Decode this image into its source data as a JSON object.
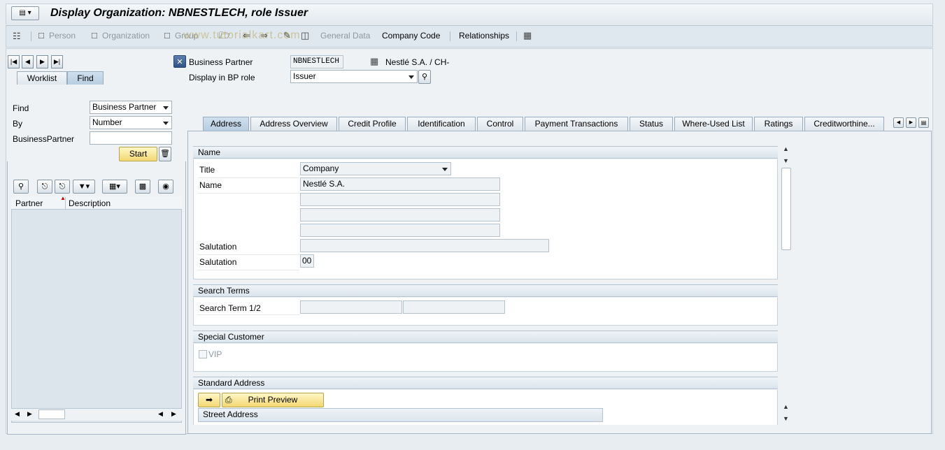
{
  "window": {
    "title": "Display Organization: NBNESTLECH, role Issuer"
  },
  "toolbar": {
    "person": "Person",
    "organization": "Organization",
    "group": "Group",
    "general_data": "General Data",
    "company_code": "Company Code",
    "relationships": "Relationships"
  },
  "header": {
    "bp_label": "Business Partner",
    "bp_value": "NBNESTLECH",
    "bp_desc": "Nestlé S.A. / CH-",
    "role_label": "Display in BP role",
    "role_value": "Issuer"
  },
  "left": {
    "tabs": [
      "Worklist",
      "Find"
    ],
    "find_label": "Find",
    "find_value": "Business Partner",
    "by_label": "By",
    "by_value": "Number",
    "bp_label": "BusinessPartner",
    "bp_value": "",
    "start_label": "Start",
    "columns": [
      "Partner",
      "Description"
    ]
  },
  "tabs": [
    "Address",
    "Address Overview",
    "Credit Profile",
    "Identification",
    "Control",
    "Payment Transactions",
    "Status",
    "Where-Used List",
    "Ratings",
    "Creditworthine..."
  ],
  "name_section": {
    "title": "Name",
    "title_label": "Title",
    "title_value": "Company",
    "name_label": "Name",
    "name1": "Nestlé S.A.",
    "name2": "",
    "name3": "",
    "name4": "",
    "salutation_label": "Salutation",
    "salutation_value": "",
    "salutation2_label": "Salutation",
    "salutation2_value": "00"
  },
  "search_section": {
    "title": "Search Terms",
    "label": "Search Term 1/2",
    "term1": "",
    "term2": ""
  },
  "special_section": {
    "title": "Special Customer",
    "vip_label": "VIP"
  },
  "standard_section": {
    "title": "Standard Address",
    "print_preview": "Print Preview",
    "street_address": "Street Address"
  },
  "watermark": "www.tutorialkart.com"
}
